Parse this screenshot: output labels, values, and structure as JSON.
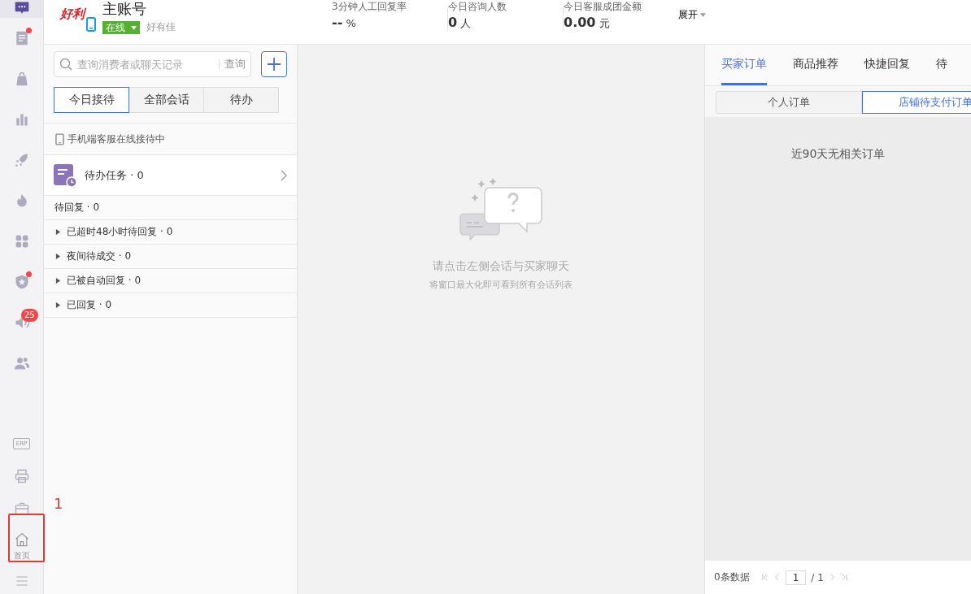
{
  "sidebar": {
    "items": [
      {
        "selected": true,
        "dot": false
      },
      {
        "selected": false,
        "dot": true
      },
      {
        "selected": false,
        "dot": false
      },
      {
        "selected": false,
        "dot": false
      },
      {
        "selected": false,
        "dot": false
      },
      {
        "selected": false,
        "dot": false
      },
      {
        "selected": false,
        "dot": false
      },
      {
        "selected": false,
        "dot": true
      },
      {
        "selected": false,
        "dot": false,
        "badge": "25"
      },
      {
        "selected": false,
        "dot": false
      }
    ],
    "erp_tag": "ERP",
    "home_label": "首页"
  },
  "annotation": {
    "label": "1"
  },
  "header": {
    "logo_text": "好利",
    "title": "主账号",
    "status": "在线",
    "account": "好有佳",
    "stats": [
      {
        "label": "3分钟人工回复率",
        "value": "--",
        "unit": "%"
      },
      {
        "label": "今日咨询人数",
        "value": "0",
        "unit": "人"
      },
      {
        "label": "今日客服成团金额",
        "value": "0.00",
        "unit": "元"
      }
    ],
    "expand": "展开"
  },
  "left": {
    "search": {
      "placeholder": "查询消费者或聊天记录",
      "button": "查询"
    },
    "tabs": [
      {
        "label": "今日接待",
        "selected": true
      },
      {
        "label": "全部会话",
        "selected": false
      },
      {
        "label": "待办",
        "selected": false
      }
    ],
    "notice": "手机端客服在线接待中",
    "task": "待办任务 · 0",
    "pending": "待回复 · 0",
    "groups": [
      {
        "label": "已超时48小时待回复 · 0",
        "expanded": false
      },
      {
        "label": "夜间待成交 · 0",
        "expanded": false
      },
      {
        "label": "已被自动回复 · 0",
        "expanded": false
      },
      {
        "label": "已回复 · 0",
        "expanded": false
      }
    ]
  },
  "center": {
    "title": "请点击左侧会话与买家聊天",
    "hint": "将窗口最大化即可看到所有会话列表"
  },
  "right": {
    "tabs": [
      {
        "label": "买家订单",
        "selected": true
      },
      {
        "label": "商品推荐",
        "selected": false
      },
      {
        "label": "快捷回复",
        "selected": false
      },
      {
        "label": "待",
        "selected": false
      }
    ],
    "subtabs": [
      {
        "label": "个人订单",
        "selected": false
      },
      {
        "label": "店铺待支付订单",
        "selected": true
      }
    ],
    "empty": "近90天无相关订单",
    "footer": {
      "count": "0条数据",
      "page": "1",
      "total": "/ 1"
    }
  }
}
